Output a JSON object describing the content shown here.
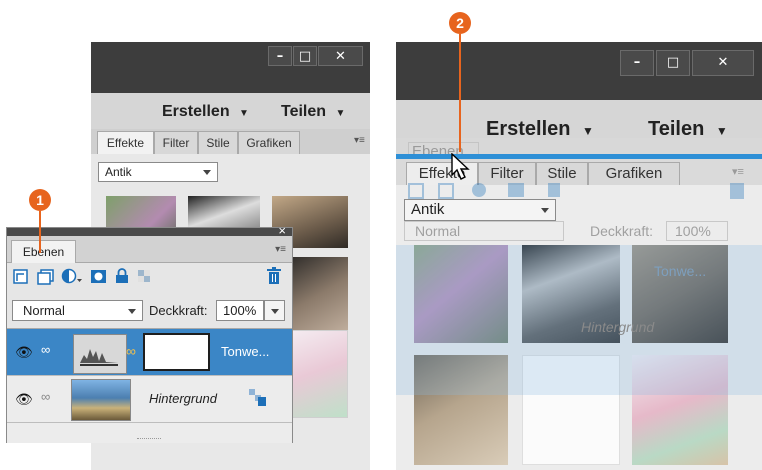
{
  "left_window": {
    "controls": {
      "minimize": "–",
      "maximize": "□",
      "close": "✕"
    },
    "menu": {
      "create": "Erstellen",
      "share": "Teilen"
    },
    "tabs": [
      "Effekte",
      "Filter",
      "Stile",
      "Grafiken"
    ],
    "active_tab": "Effekte",
    "effect_dropdown": "Antik"
  },
  "layers_panel": {
    "tab_label": "Ebenen",
    "close_glyph": "×",
    "menu_glyph": "▾≡",
    "blend_mode": "Normal",
    "opacity_label": "Deckkraft:",
    "opacity_value": "100%",
    "layers": [
      {
        "name": "Tonwe...",
        "selected": true
      },
      {
        "name": "Hintergrund",
        "selected": false
      }
    ]
  },
  "right_window": {
    "controls": {
      "minimize": "–",
      "maximize": "□",
      "close": "✕"
    },
    "menu": {
      "create": "Erstellen",
      "share": "Teilen"
    },
    "tabs": [
      "Effekte",
      "Filter",
      "Stile",
      "Grafiken"
    ],
    "ghost_tab": "Ebenen",
    "effect_dropdown": "Antik",
    "ghost_blend_mode": "Normal",
    "ghost_opacity_label": "Deckkraft:",
    "ghost_opacity_value": "100%",
    "ghost_layer_names": [
      "Tonwe...",
      "Hintergrund"
    ]
  },
  "callouts": [
    "1",
    "2"
  ],
  "colors": {
    "accent_blue": "#2e8fd6",
    "selected_row": "#3b86c6",
    "callout_orange": "#e7641e"
  }
}
